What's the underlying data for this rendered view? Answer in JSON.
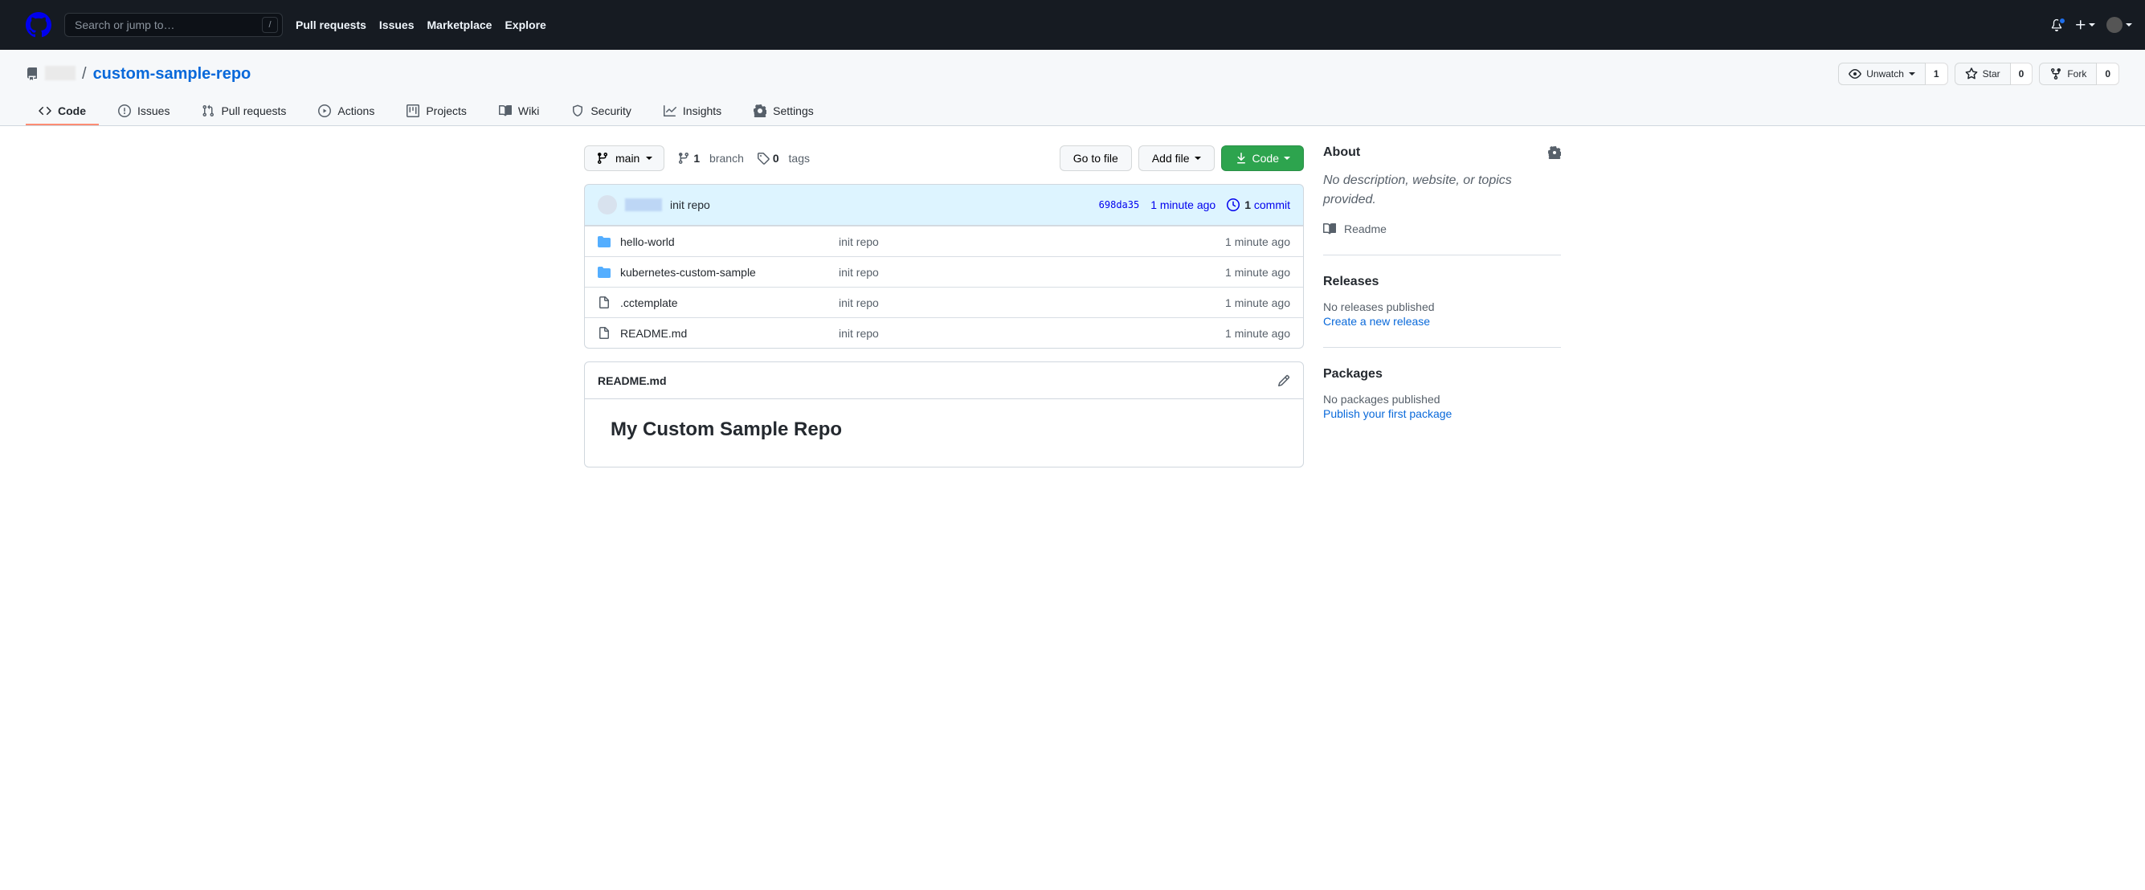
{
  "header": {
    "search_placeholder": "Search or jump to…",
    "slash": "/",
    "nav": {
      "pull_requests": "Pull requests",
      "issues": "Issues",
      "marketplace": "Marketplace",
      "explore": "Explore"
    }
  },
  "repo": {
    "separator": "/",
    "name": "custom-sample-repo",
    "actions": {
      "unwatch": "Unwatch",
      "watch_count": "1",
      "star": "Star",
      "star_count": "0",
      "fork": "Fork",
      "fork_count": "0"
    }
  },
  "tabs": {
    "code": "Code",
    "issues": "Issues",
    "pull_requests": "Pull requests",
    "actions": "Actions",
    "projects": "Projects",
    "wiki": "Wiki",
    "security": "Security",
    "insights": "Insights",
    "settings": "Settings"
  },
  "files": {
    "branch": "main",
    "branches_count": "1",
    "branches_label": "branch",
    "tags_count": "0",
    "tags_label": "tags",
    "go_to_file": "Go to file",
    "add_file": "Add file",
    "code_btn": "Code",
    "latest_commit": {
      "message": "init repo",
      "sha": "698da35",
      "time": "1 minute ago",
      "commits_count": "1",
      "commits_label": "commit"
    },
    "rows": [
      {
        "type": "dir",
        "name": "hello-world",
        "msg": "init repo",
        "time": "1 minute ago"
      },
      {
        "type": "dir",
        "name": "kubernetes-custom-sample",
        "msg": "init repo",
        "time": "1 minute ago"
      },
      {
        "type": "file",
        "name": ".cctemplate",
        "msg": "init repo",
        "time": "1 minute ago"
      },
      {
        "type": "file",
        "name": "README.md",
        "msg": "init repo",
        "time": "1 minute ago"
      }
    ]
  },
  "readme": {
    "filename": "README.md",
    "heading": "My Custom Sample Repo"
  },
  "sidebar": {
    "about_title": "About",
    "about_text": "No description, website, or topics provided.",
    "readme_link": "Readme",
    "releases_title": "Releases",
    "releases_empty": "No releases published",
    "releases_link": "Create a new release",
    "packages_title": "Packages",
    "packages_empty": "No packages published",
    "packages_link": "Publish your first package"
  }
}
